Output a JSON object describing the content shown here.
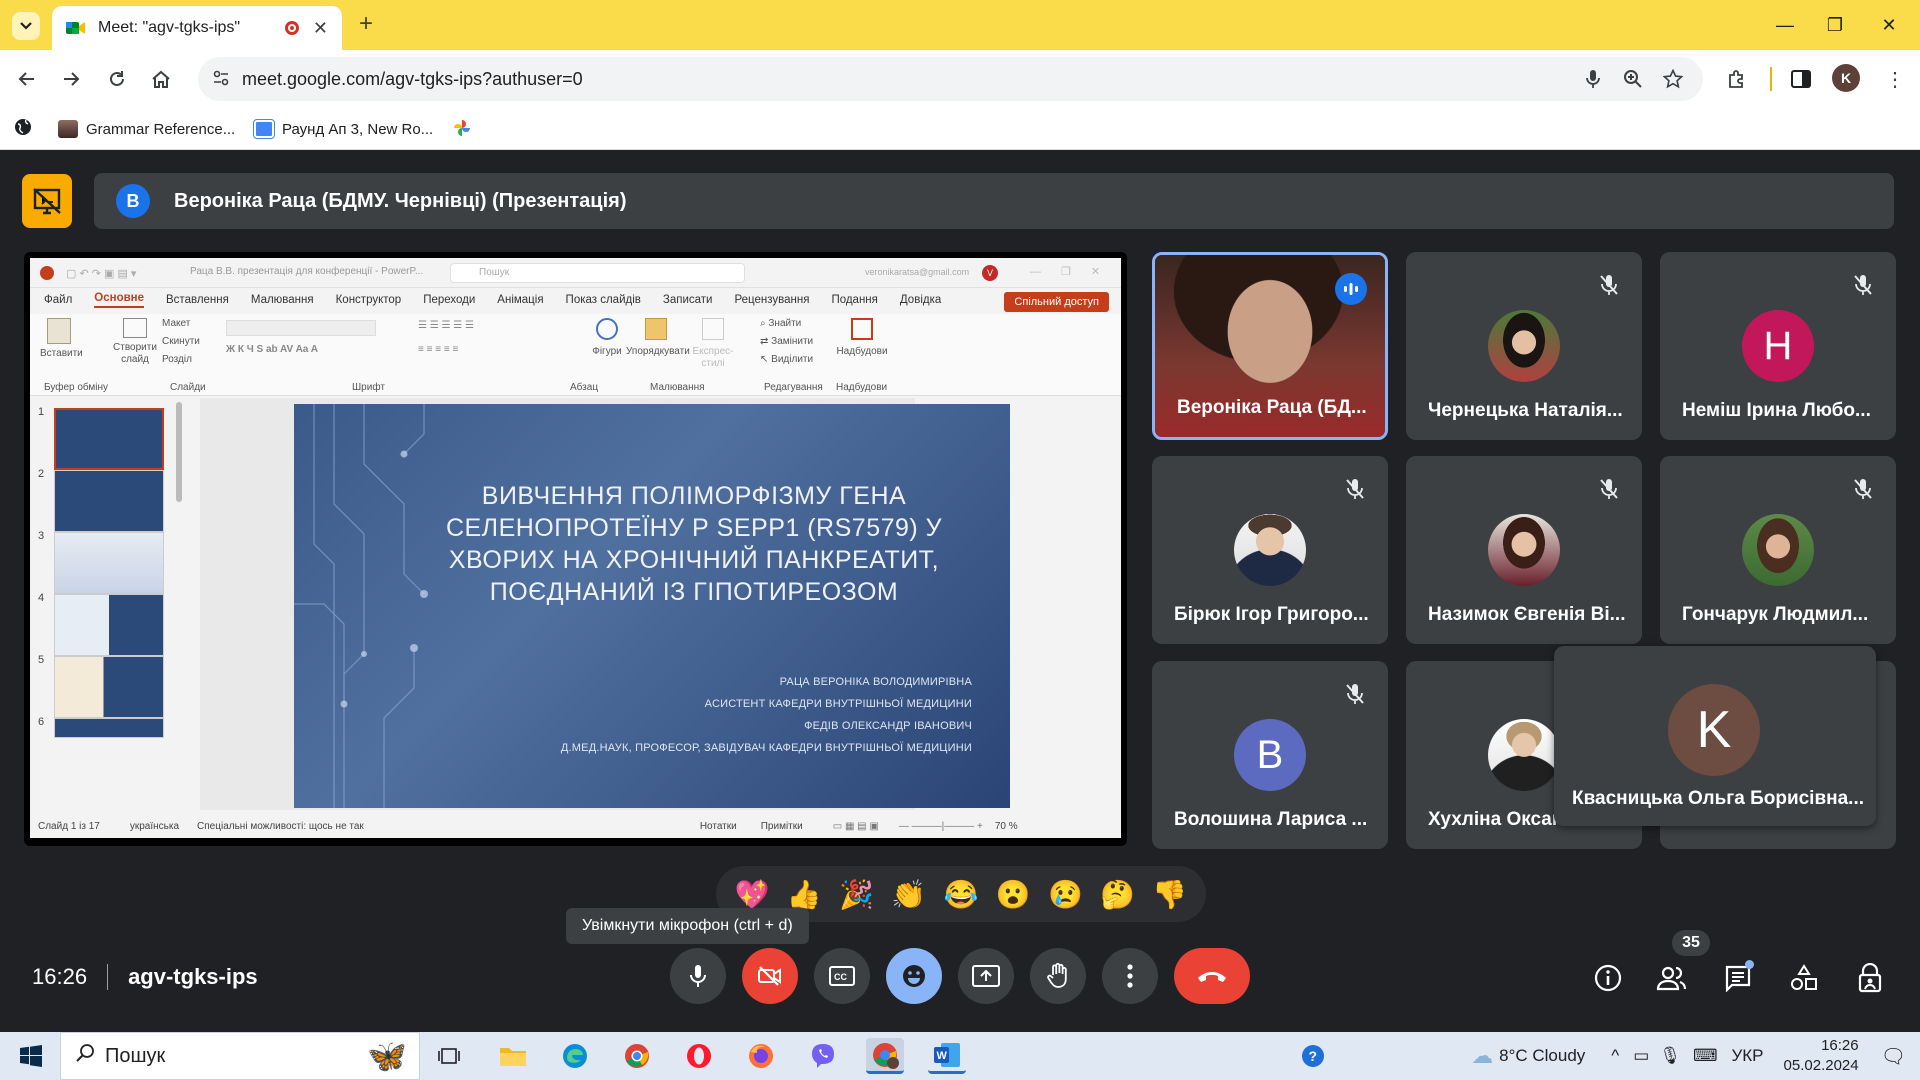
{
  "browser": {
    "tab_title": "Meet: \"agv-tgks-ips\"",
    "url": "meet.google.com/agv-tgks-ips?authuser=0",
    "profile_initial": "K",
    "bookmarks": [
      "Grammar Reference...",
      "Раунд Ап 3, New Ro..."
    ]
  },
  "presenter": {
    "avatar_letter": "B",
    "title": "Вероніка Раца (БДМУ. Чернівці) (Презентація)"
  },
  "powerpoint": {
    "title": "Раца В.В. презентація для конференції - PowerP...",
    "search": "Пошук",
    "account": "veronikaratsa@gmail.com",
    "menu": [
      "Файл",
      "Основне",
      "Вставлення",
      "Малювання",
      "Конструктор",
      "Переходи",
      "Анімація",
      "Показ слайдів",
      "Записати",
      "Рецензування",
      "Подання",
      "Довідка"
    ],
    "share": "Спільний доступ",
    "ribbon_groups": [
      "Буфер обміну",
      "Слайди",
      "Шрифт",
      "Абзац",
      "Малювання",
      "Редагування",
      "Надбудови"
    ],
    "ribbon_buttons": {
      "paste": "Вставити",
      "new_slide": "Створити слайд",
      "layout": "Макет",
      "reset": "Скинути",
      "section": "Розділ",
      "shapes": "Фігури",
      "arrange": "Упорядкувати",
      "quick_styles": "Експрес-стилі",
      "find": "Знайти",
      "replace": "Замінити",
      "select": "Виділити",
      "addins": "Надбудови"
    },
    "thumb_numbers": [
      "1",
      "2",
      "3",
      "4",
      "5",
      "6"
    ],
    "slide": {
      "title": "ВИВЧЕННЯ ПОЛІМОРФІЗМУ ГЕНА СЕЛЕНОПРОТЕЇНУ Р SEPP1 (RS7579) У ХВОРИХ НА ХРОНІЧНИЙ ПАНКРЕАТИТ, ПОЄДНАНИЙ ІЗ ГІПОТИРЕОЗОМ",
      "lines": [
        "РАЦА ВЕРОНІКА ВОЛОДИМИРІВНА",
        "АСИСТЕНТ КАФЕДРИ ВНУТРІШНЬОЇ МЕДИЦИНИ",
        "ФЕДІВ ОЛЕКСАНДР ІВАНОВИЧ",
        "Д.МЕД.НАУК, ПРОФЕСОР, ЗАВІДУВАЧ КАФЕДРИ ВНУТРІШНЬОЇ МЕДИЦИНИ"
      ]
    },
    "status": {
      "slide": "Слайд 1 із 17",
      "lang": "українська",
      "accessibility": "Спеціальні можливості: щось не так",
      "notes": "Нотатки",
      "comments": "Примітки",
      "zoom": "70 %"
    }
  },
  "participants": [
    {
      "name": "Вероніка Раца (БД...",
      "speaking": true
    },
    {
      "name": "Чернецька Наталія...",
      "muted": true
    },
    {
      "name": "Неміш Ірина Любо...",
      "initial": "H",
      "color": "#c2185b",
      "muted": true
    },
    {
      "name": "Бірюк Ігор Григоро...",
      "muted": true
    },
    {
      "name": "Назимок Євгенія Ві...",
      "muted": true
    },
    {
      "name": "Гончарук Людмил...",
      "muted": true
    },
    {
      "name": "Волошина Лариса ...",
      "initial": "B",
      "color": "#5c6bc0",
      "muted": true
    },
    {
      "name": "Хухліна Оксан..."
    },
    {
      "name": "Квасницька Ольга Борисівна...",
      "initial": "K",
      "color": "#6d4c41"
    }
  ],
  "reactions": [
    "💖",
    "👍",
    "🎉",
    "👏",
    "😂",
    "😮",
    "😢",
    "🤔",
    "👎"
  ],
  "tooltip": "Увімкнути мікрофон (ctrl + d)",
  "meeting": {
    "time": "16:26",
    "code": "agv-tgks-ips",
    "participant_count": "35"
  },
  "taskbar": {
    "search": "Пошук",
    "weather": "8°C  Cloudy",
    "lang": "УКР",
    "time": "16:26",
    "date": "05.02.2024"
  },
  "colors": {
    "tab_bar": "#fadb4a",
    "meet_bg": "#202124",
    "tile_bg": "#3c4043",
    "end_call": "#ea4335",
    "active_speaker": "#8ab4f8"
  }
}
